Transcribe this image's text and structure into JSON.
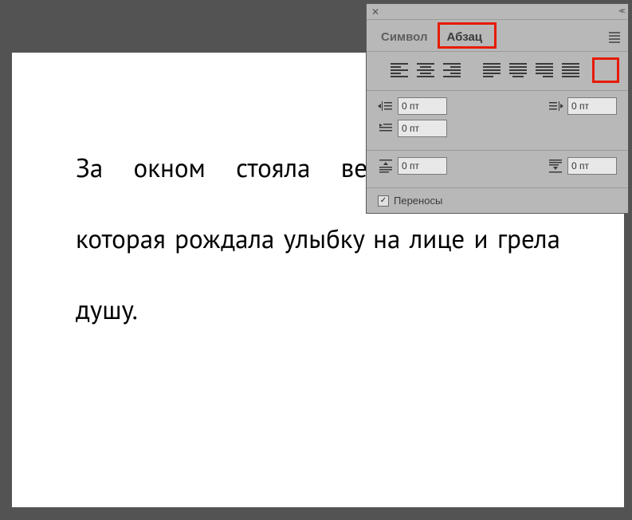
{
  "document": {
    "text": "За окном стояла весенняя погода, которая рождала улыбку на лице и грела душу."
  },
  "panel": {
    "tabs": {
      "symbol": "Символ",
      "paragraph": "Абзац"
    },
    "indents": {
      "left": "0 пт",
      "right": "0 пт",
      "firstLine": "0 пт",
      "spaceBefore": "0 пт",
      "spaceAfter": "0 пт"
    },
    "hyphenation": {
      "label": "Переносы",
      "checked": "✓"
    }
  }
}
